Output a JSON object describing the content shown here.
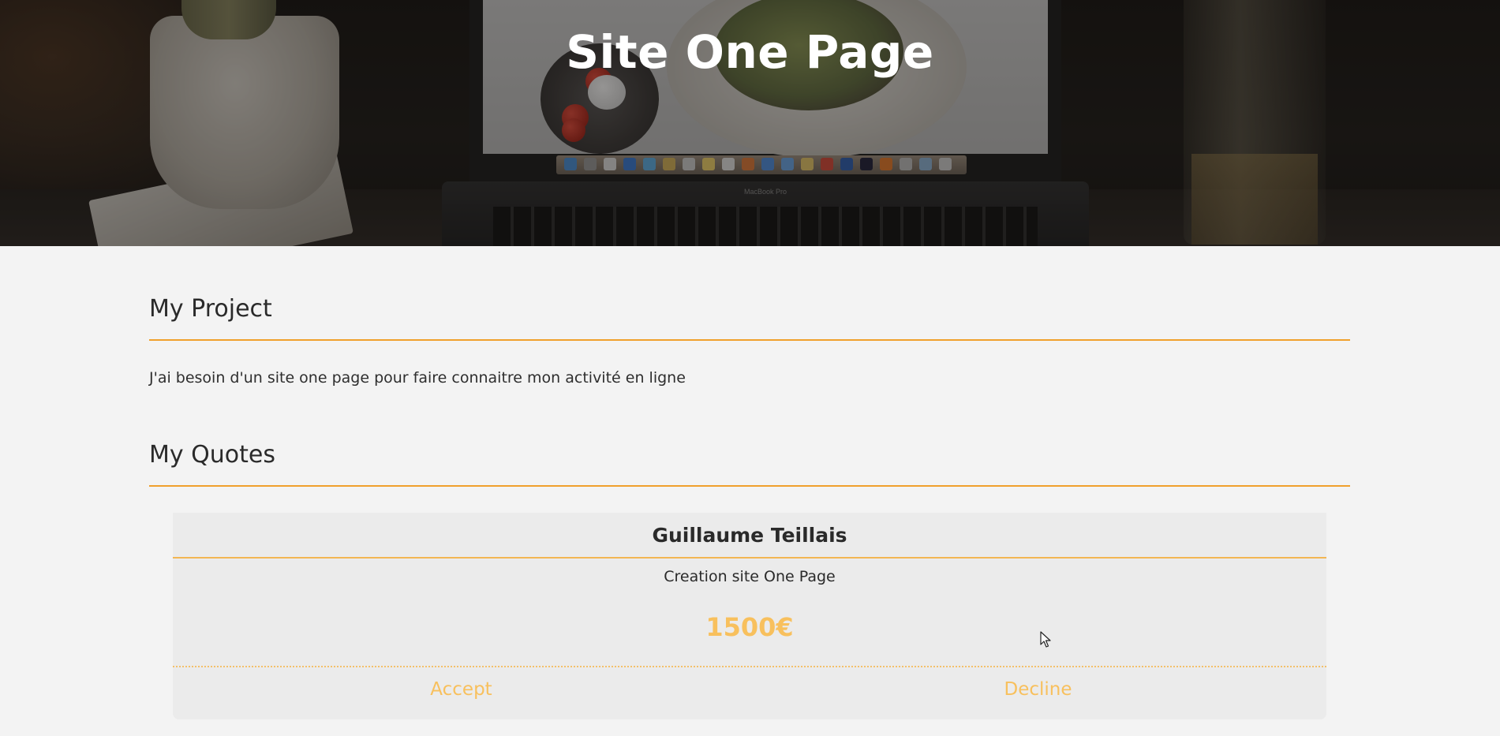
{
  "hero": {
    "title": "Site One Page",
    "laptop_label": "MacBook Pro"
  },
  "project": {
    "heading": "My Project",
    "description": "J'ai besoin d'un site one page pour faire connaitre mon activité en ligne"
  },
  "quotes": {
    "heading": "My Quotes",
    "items": [
      {
        "author": "Guillaume Teillais",
        "description": "Creation site One Page",
        "price": "1500€",
        "accept_label": "Accept",
        "decline_label": "Decline"
      }
    ]
  },
  "colors": {
    "accent": "#f0a02c",
    "price": "#f8c05d",
    "background": "#f3f3f3",
    "card": "#ebebeb"
  },
  "icons": {
    "cursor": "mouse-pointer-icon"
  }
}
